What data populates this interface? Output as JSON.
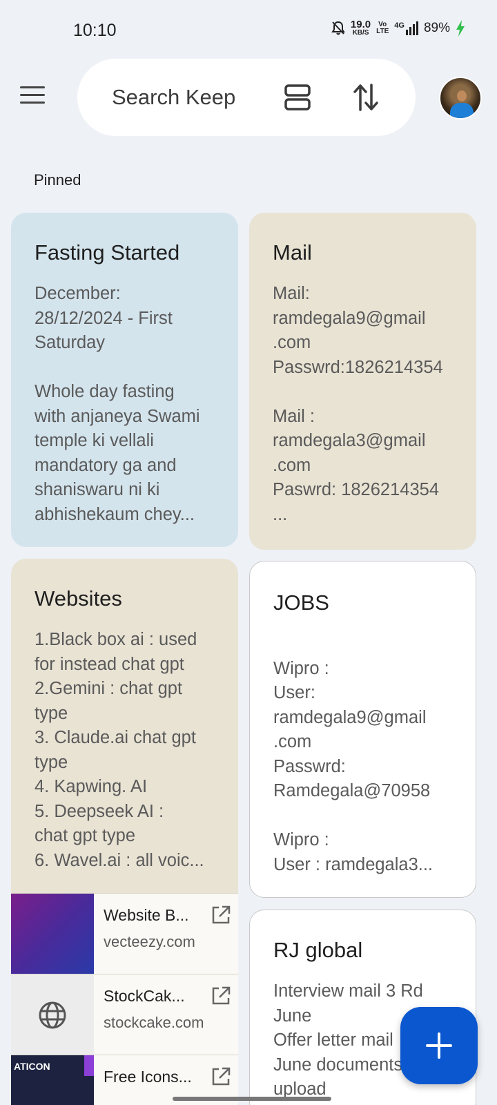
{
  "status": {
    "time": "10:10",
    "speed_value": "19.0",
    "speed_unit": "KB/S",
    "volte_top": "Vo",
    "volte_bottom": "LTE",
    "network": "4G",
    "battery": "89%"
  },
  "toolbar": {
    "search_placeholder": "Search Keep"
  },
  "sections": {
    "pinned_label": "Pinned"
  },
  "notes": [
    {
      "title": "Fasting Started",
      "body": "December:\n28/12/2024 - First\nSaturday\n\nWhole day fasting\nwith anjaneya Swami\ntemple ki vellali\nmandatory ga and\nshaniswaru ni ki\nabhishekaum chey..."
    },
    {
      "title": "Mail",
      "body": "Mail:\nramdegala9@gmail\n.com\nPasswrd:1826214354\n\nMail :\nramdegala3@gmail\n.com\nPaswrd: 1826214354\n..."
    },
    {
      "title": "Websites",
      "body": "1.Black box ai : used\nfor instead chat gpt\n2.Gemini : chat gpt\ntype\n3. Claude.ai chat gpt\ntype\n4. Kapwing. AI\n5. Deepseek AI :\nchat gpt type\n6. Wavel.ai : all voic...",
      "links": [
        {
          "title": "Website B...",
          "domain": "vecteezy.com"
        },
        {
          "title": "StockCak...",
          "domain": "stockcake.com"
        },
        {
          "title": "Free Icons...",
          "domain": ""
        }
      ]
    },
    {
      "title": "JOBS",
      "body": "\nWipro :\nUser:\nramdegala9@gmail\n.com\nPasswrd:\nRamdegala@70958\n\nWipro :\nUser : ramdegala3..."
    },
    {
      "title": "RJ global",
      "body": "Interview mail 3 Rd\nJune\nOffer letter mail\nJune documents\nupload"
    }
  ],
  "thumb_text": "ATICON",
  "colors": {
    "fab": "#0b57d0",
    "card_blue": "#d4e4ed",
    "card_beige": "#e9e3d4",
    "background": "#eef1f6"
  }
}
